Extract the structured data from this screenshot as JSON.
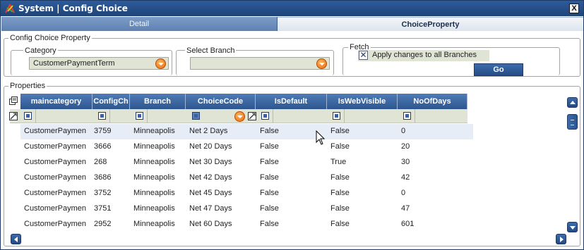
{
  "window": {
    "title": "System | Config Choice",
    "close_label": "X"
  },
  "tabs": [
    {
      "label": "Detail",
      "active": false
    },
    {
      "label": "ChoiceProperty",
      "active": true
    }
  ],
  "config_choice_property": {
    "legend": "Config Choice Property",
    "category": {
      "label": "Category",
      "value": "CustomerPaymentTerm"
    },
    "select_branch": {
      "label": "Select Branch",
      "value": ""
    },
    "fetch": {
      "label": "Fetch",
      "apply_all_label": "Apply changes to all Branches",
      "apply_all_checked": true,
      "go_label": "Go"
    }
  },
  "properties": {
    "legend": "Properties",
    "columns": [
      "maincategory",
      "ConfigCh",
      "Branch",
      "ChoiceCode",
      "IsDefault",
      "IsWebVisible",
      "NoOfDays"
    ],
    "rows": [
      [
        "CustomerPaymen",
        "3759",
        "Minneapolis",
        "Net 2 Days",
        "False",
        "False",
        "0"
      ],
      [
        "CustomerPaymen",
        "3666",
        "Minneapolis",
        "Net 20 Days",
        "False",
        "False",
        "20"
      ],
      [
        "CustomerPaymen",
        "268",
        "Minneapolis",
        "Net 30 Days",
        "False",
        "True",
        "30"
      ],
      [
        "CustomerPaymen",
        "3686",
        "Minneapolis",
        "Net 42 Days",
        "False",
        "False",
        "42"
      ],
      [
        "CustomerPaymen",
        "3752",
        "Minneapolis",
        "Net 45 Days",
        "False",
        "False",
        "0"
      ],
      [
        "CustomerPaymen",
        "3751",
        "Minneapolis",
        "Net 47 Days",
        "False",
        "False",
        "47"
      ],
      [
        "CustomerPaymen",
        "2952",
        "Minneapolis",
        "Net 60 Days",
        "False",
        "False",
        "601"
      ]
    ],
    "selected_row": 0
  },
  "colors": {
    "title_bar": "#1e4478",
    "header": "#2d568f",
    "field_bg": "#dfe4d5",
    "accent_orange": "#e96a0c"
  },
  "icons": {
    "app": "system-app-icon",
    "combo_dropdown": "orange-dropdown-icon",
    "grid_column_chooser": "column-chooser-icon",
    "grid_filter_clear": "filter-clear-icon"
  }
}
